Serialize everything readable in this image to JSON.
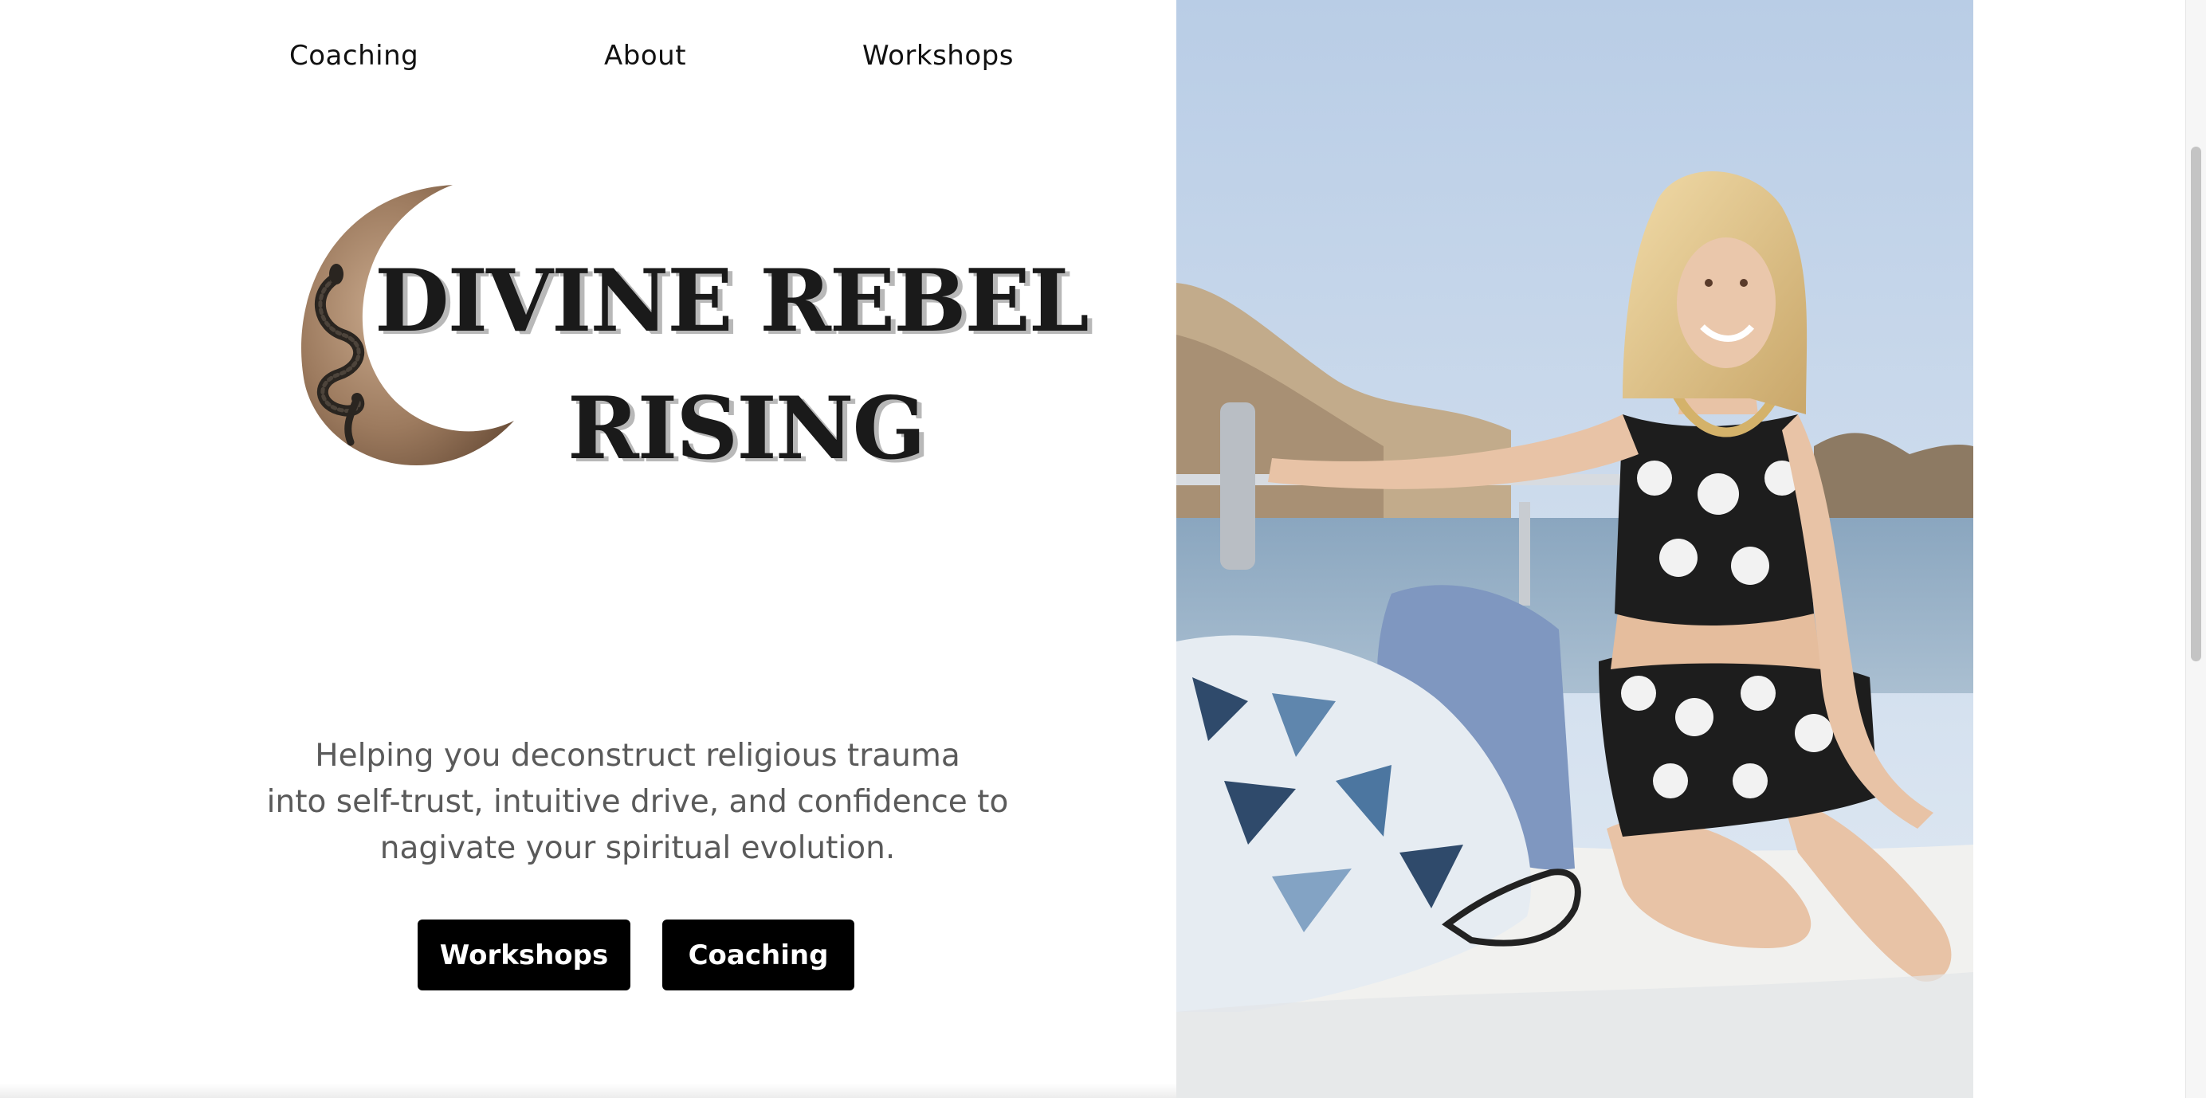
{
  "nav": {
    "coaching": "Coaching",
    "about": "About",
    "workshops": "Workshops"
  },
  "logo": {
    "line1": "DIVINE REBEL",
    "line2": "RISING",
    "icon": "crescent-moon-with-snake"
  },
  "hero": {
    "tagline_line1": "Helping you deconstruct religious trauma",
    "tagline_line2": "into self-trust, intuitive drive, and confidence to",
    "tagline_line3": "nagivate your spiritual evolution.",
    "workshops_button": "Workshops",
    "coaching_button": "Coaching"
  },
  "colors": {
    "button_bg": "#000000",
    "button_text": "#ffffff",
    "tagline_text": "#5a5a5a",
    "moon_brown": "#9c7a5e"
  },
  "photo": {
    "subject": "woman smiling on a boat deck"
  }
}
